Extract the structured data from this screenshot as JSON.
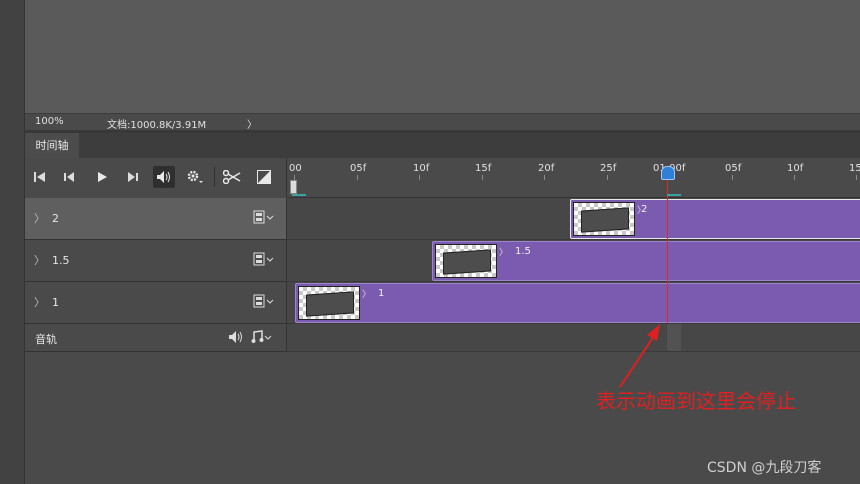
{
  "status_bar": {
    "zoom": "100%",
    "doc_info": "文档:1000.8K/3.91M",
    "arrow": "〉"
  },
  "timeline_tab": {
    "label": "时间轴"
  },
  "controls": {
    "icons": [
      "first-frame-icon",
      "previous-frame-icon",
      "play-icon",
      "next-frame-icon",
      "audio-toggle-icon",
      "settings-icon",
      "split-clip-icon",
      "transition-icon"
    ]
  },
  "ruler": {
    "labels": [
      "00",
      "05f",
      "10f",
      "15f",
      "20f",
      "25f",
      "01:00f",
      "05f",
      "10f",
      "15"
    ]
  },
  "layers": [
    {
      "name": "2",
      "chevron": "〉",
      "clip_label": "2"
    },
    {
      "name": "1.5",
      "chevron": "〉",
      "clip_label": "1.5"
    },
    {
      "name": "1",
      "chevron": "〉",
      "clip_label": "1"
    }
  ],
  "audio_track": {
    "label": "音轨"
  },
  "annotation": {
    "text": "表示动画到这里会停止",
    "color": "#e02020"
  },
  "watermark": {
    "text": "CSDN @九段刀客"
  },
  "colors": {
    "clip": "#7b5bb0",
    "playhead": "#e0282a",
    "playhead_handle": "#2f7fd8",
    "panel": "#4a4a4a"
  }
}
